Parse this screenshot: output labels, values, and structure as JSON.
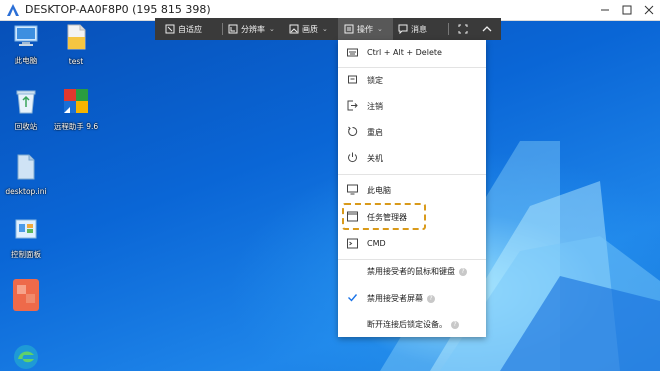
{
  "window": {
    "title": "DESKTOP-AA0F8P0 (195 815 398)"
  },
  "desktop_icons": [
    {
      "label": "此电脑",
      "icon": "this-pc-icon"
    },
    {
      "label": "test",
      "icon": "folder-icon"
    },
    {
      "label": "回收站",
      "icon": "recycle-bin-icon"
    },
    {
      "label": "远程助手 9.6",
      "icon": "remote-assistant-icon"
    },
    {
      "label": "desktop.ini",
      "icon": "file-icon"
    },
    {
      "label": "控制面板",
      "icon": "control-panel-icon"
    },
    {
      "label": "",
      "icon": "blurred-app-icon"
    },
    {
      "label": "",
      "icon": "edge-icon"
    }
  ],
  "toolbar": {
    "adapt": "自适应",
    "resolution": "分辨率",
    "quality": "画质",
    "operation": "操作",
    "message": "消息"
  },
  "menu": {
    "items": [
      {
        "label": "Ctrl + Alt + Delete",
        "icon": "keyboard-icon"
      },
      {
        "label": "锁定",
        "icon": "lock-icon"
      },
      {
        "label": "注销",
        "icon": "logout-icon"
      },
      {
        "label": "重启",
        "icon": "restart-icon"
      },
      {
        "label": "关机",
        "icon": "power-icon"
      },
      {
        "label": "此电脑",
        "icon": "monitor-icon"
      },
      {
        "label": "任务管理器",
        "icon": "window-icon"
      },
      {
        "label": "CMD",
        "icon": "terminal-icon"
      },
      {
        "label": "禁用接受者的鼠标和键盘",
        "icon": "help-icon"
      },
      {
        "label": "禁用接受者屏幕",
        "icon": "checkmark-icon",
        "checked": true
      },
      {
        "label": "断开连接后锁定设备。",
        "icon": "help-icon"
      }
    ]
  },
  "colors": {
    "toolbar": "#3a3a3a",
    "highlight": "#d99a1a",
    "check": "#1a73e8"
  }
}
